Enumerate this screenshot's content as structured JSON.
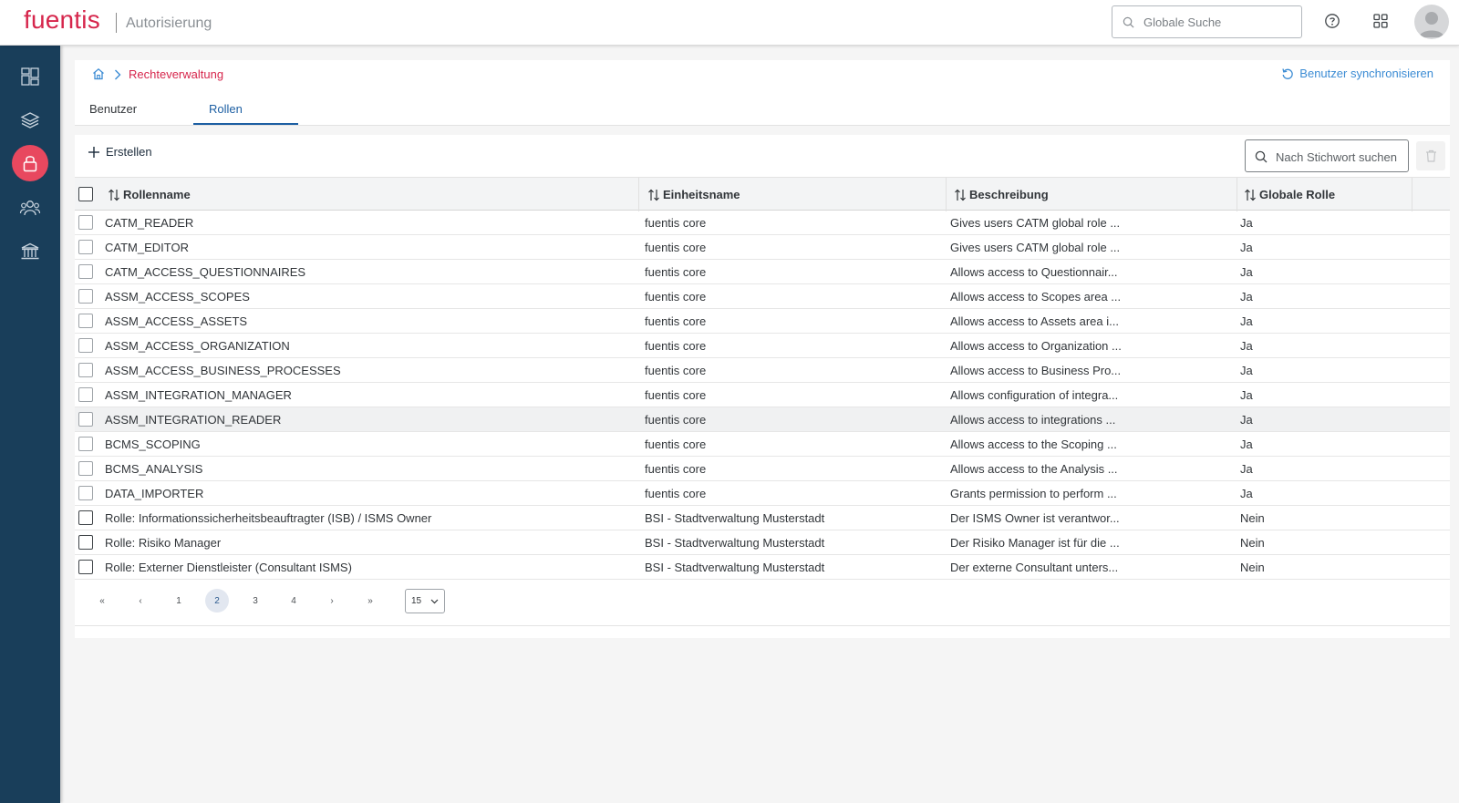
{
  "header": {
    "logo_text": "fuentis",
    "app_title": "Autorisierung",
    "search_placeholder": "Globale Suche",
    "help_icon": "help-circle-icon",
    "apps_icon": "app-grid-icon",
    "avatar_icon": "user-avatar-icon"
  },
  "sidebar": {
    "items": [
      {
        "name": "dashboard",
        "icon": "dashboard-icon",
        "active": false
      },
      {
        "name": "layers",
        "icon": "layers-icon",
        "active": false
      },
      {
        "name": "authorization",
        "icon": "lock-icon",
        "active": true
      },
      {
        "name": "users",
        "icon": "users-group-icon",
        "active": false
      },
      {
        "name": "institution",
        "icon": "bank-icon",
        "active": false
      }
    ]
  },
  "breadcrumb": {
    "home_icon": "home-icon",
    "current": "Rechteverwaltung"
  },
  "sync_button": "Benutzer synchronisieren",
  "tabs": [
    {
      "label": "Benutzer",
      "active": false
    },
    {
      "label": "Rollen",
      "active": true
    }
  ],
  "toolbar": {
    "create_label": "Erstellen",
    "search_placeholder": "Nach Stichwort suchen"
  },
  "table": {
    "columns": [
      "Rollenname",
      "Einheitsname",
      "Beschreibung",
      "Globale Rolle"
    ],
    "rows": [
      {
        "name": "CATM_READER",
        "unit": "fuentis core",
        "desc": "Gives users CATM global role ...",
        "global": "Ja"
      },
      {
        "name": "CATM_EDITOR",
        "unit": "fuentis core",
        "desc": "Gives users CATM global role ...",
        "global": "Ja"
      },
      {
        "name": "CATM_ACCESS_QUESTIONNAIRES",
        "unit": "fuentis core",
        "desc": "Allows access to Questionnair...",
        "global": "Ja"
      },
      {
        "name": "ASSM_ACCESS_SCOPES",
        "unit": "fuentis core",
        "desc": "Allows access to Scopes area ...",
        "global": "Ja"
      },
      {
        "name": "ASSM_ACCESS_ASSETS",
        "unit": "fuentis core",
        "desc": "Allows access to Assets area i...",
        "global": "Ja"
      },
      {
        "name": "ASSM_ACCESS_ORGANIZATION",
        "unit": "fuentis core",
        "desc": "Allows access to Organization ...",
        "global": "Ja"
      },
      {
        "name": "ASSM_ACCESS_BUSINESS_PROCESSES",
        "unit": "fuentis core",
        "desc": "Allows access to Business Pro...",
        "global": "Ja"
      },
      {
        "name": "ASSM_INTEGRATION_MANAGER",
        "unit": "fuentis core",
        "desc": "Allows configuration of integra...",
        "global": "Ja"
      },
      {
        "name": "ASSM_INTEGRATION_READER",
        "unit": "fuentis core",
        "desc": "Allows access to integrations ...",
        "global": "Ja"
      },
      {
        "name": "BCMS_SCOPING",
        "unit": "fuentis core",
        "desc": "Allows access to the Scoping ...",
        "global": "Ja"
      },
      {
        "name": "BCMS_ANALYSIS",
        "unit": "fuentis core",
        "desc": "Allows access to the Analysis ...",
        "global": "Ja"
      },
      {
        "name": "DATA_IMPORTER",
        "unit": "fuentis core",
        "desc": "Grants permission to perform ...",
        "global": "Ja"
      },
      {
        "name": "Rolle: Informationssicherheitsbeauftragter (ISB) / ISMS Owner",
        "unit": "BSI - Stadtverwaltung Musterstadt",
        "desc": "Der ISMS Owner ist verantwor...",
        "global": "Nein"
      },
      {
        "name": "Rolle: Risiko Manager",
        "unit": "BSI - Stadtverwaltung Musterstadt",
        "desc": "Der Risiko Manager ist für die ...",
        "global": "Nein"
      },
      {
        "name": "Rolle: Externer Dienstleister (Consultant ISMS)",
        "unit": "BSI - Stadtverwaltung Musterstadt",
        "desc": "Der externe Consultant unters...",
        "global": "Nein"
      }
    ]
  },
  "pagination": {
    "first": "«",
    "prev": "‹",
    "pages": [
      "1",
      "2",
      "3",
      "4"
    ],
    "current": "2",
    "next": "›",
    "last": "»",
    "page_size": "15"
  },
  "colors": {
    "brand": "#d6264c",
    "sidebar": "#193e5a",
    "active_side": "#e8485f",
    "link": "#3c8cd4",
    "tab_active": "#1d5fa3"
  }
}
